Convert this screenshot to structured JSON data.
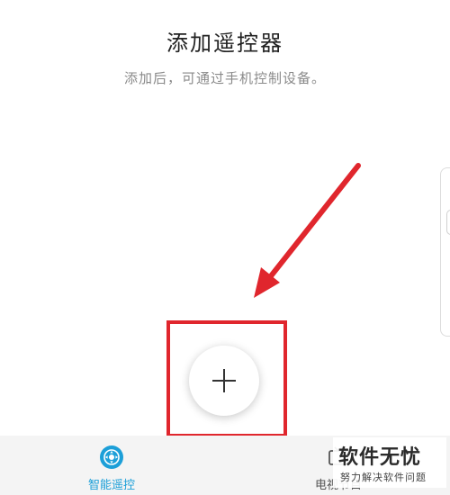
{
  "header": {
    "title": "添加遥控器",
    "subtitle": "添加后，可通过手机控制设备。"
  },
  "add_button": {
    "icon": "plus-icon"
  },
  "annotation": {
    "color": "#e0262d"
  },
  "tabbar": {
    "tabs": [
      {
        "label": "智能遥控",
        "icon": "remote-control-icon",
        "active": true,
        "color": "#1c9fd8"
      },
      {
        "label": "电视节目",
        "icon": "tv-icon",
        "active": false,
        "color": "#555555"
      }
    ]
  },
  "watermark": {
    "title": "软件无忧",
    "subtitle": "努力解决软件问题"
  }
}
